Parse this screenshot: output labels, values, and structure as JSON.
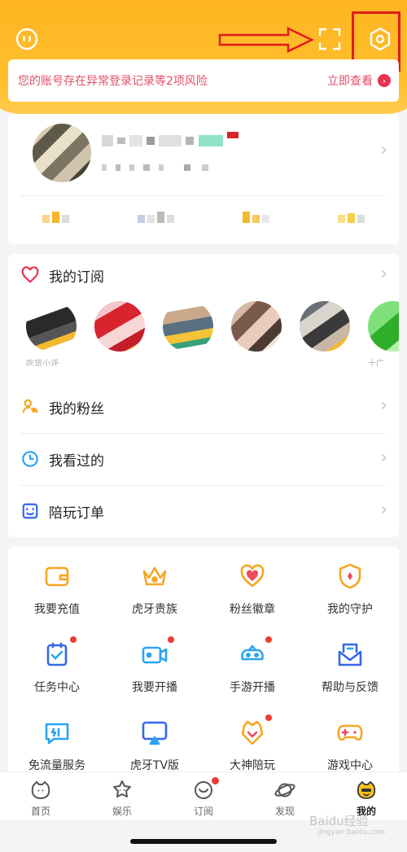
{
  "alert": {
    "message": "您的账号存在异常登录记录等2项风险",
    "action": "立即查看",
    "action_icon": "›"
  },
  "header_icons": [
    "message-icon",
    "scan-icon",
    "settings-icon"
  ],
  "menu": {
    "subscriptions_title": "我的订阅",
    "fans": "我的粉丝",
    "history": "我看过的",
    "orders": "陪玩订单"
  },
  "subscriptions": [
    {
      "name": "吃货小评"
    },
    {
      "name": ""
    },
    {
      "name": ""
    },
    {
      "name": ""
    },
    {
      "name": ""
    },
    {
      "name": "十广"
    }
  ],
  "grid": [
    {
      "label": "我要充值",
      "dot": false,
      "icon": "wallet-icon"
    },
    {
      "label": "虎牙贵族",
      "dot": false,
      "icon": "crown-icon"
    },
    {
      "label": "粉丝徽章",
      "dot": false,
      "icon": "heart-badge-icon"
    },
    {
      "label": "我的守护",
      "dot": false,
      "icon": "shield-icon"
    },
    {
      "label": "任务中心",
      "dot": true,
      "icon": "task-icon"
    },
    {
      "label": "我要开播",
      "dot": true,
      "icon": "camera-icon"
    },
    {
      "label": "手游开播",
      "dot": true,
      "icon": "gamepad-cloud-icon"
    },
    {
      "label": "帮助与反馈",
      "dot": false,
      "icon": "help-mail-icon"
    },
    {
      "label": "免流量服务",
      "dot": false,
      "icon": "data-card-icon"
    },
    {
      "label": "虎牙TV版",
      "dot": false,
      "icon": "tv-icon"
    },
    {
      "label": "大神陪玩",
      "dot": true,
      "icon": "companion-icon"
    },
    {
      "label": "游戏中心",
      "dot": false,
      "icon": "controller-icon"
    }
  ],
  "tabs": [
    {
      "label": "首页",
      "icon": "home-tiger-icon",
      "active": false
    },
    {
      "label": "娱乐",
      "icon": "entertainment-icon",
      "active": false
    },
    {
      "label": "订阅",
      "icon": "subscribe-icon",
      "active": false,
      "dot": true
    },
    {
      "label": "发现",
      "icon": "planet-icon",
      "active": false
    },
    {
      "label": "我的",
      "icon": "profile-tiger-icon",
      "active": true
    }
  ],
  "watermark": {
    "text": "Baidu经验",
    "sub": "jingyan.baidu.com"
  },
  "colors": {
    "brand_yellow": "#ffb521",
    "alert_red": "#e24e6b",
    "accent_orange": "#f5a623"
  }
}
